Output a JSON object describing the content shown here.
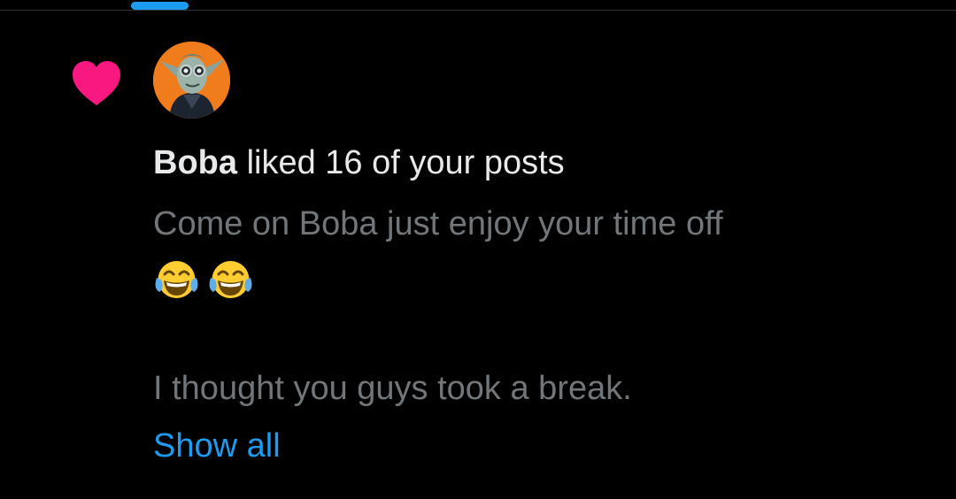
{
  "colors": {
    "background": "#000000",
    "heart": "#f91880",
    "accent": "#1d9bf0",
    "primary_text": "#e7e9ea",
    "secondary_text": "#71767b",
    "avatar_background": "#f07c1b"
  },
  "tabs": {
    "active_indicator": "tab-indicator"
  },
  "notification": {
    "icon": "heart-icon",
    "avatar_icon": "goblin-avatar",
    "user_name": "Boba",
    "action_text": "liked 16 of your posts",
    "post_line_1": "Come on Boba just enjoy your time off",
    "emoji_1": "face-with-tears-of-joy",
    "emoji_2": "face-with-tears-of-joy",
    "post_line_2": "I thought you guys took a break.",
    "show_all_label": "Show all"
  }
}
